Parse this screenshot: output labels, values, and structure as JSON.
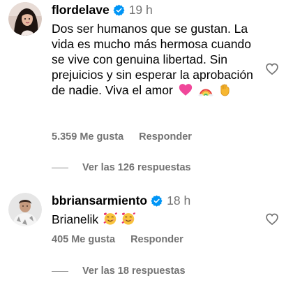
{
  "comments": [
    {
      "username": "flordelave",
      "verified": true,
      "time": "19 h",
      "text": "Dos ser humanos que se gustan. La vida es mucho más hermosa cuando se vive con genuina libertad. Sin prejuicios y sin esperar la aprobación de nadie. Viva el amor",
      "emojis": [
        "pink-heart-icon",
        "rainbow-icon",
        "raised-fist-icon"
      ],
      "likes_label": "5.359 Me gusta",
      "reply_label": "Responder",
      "view_replies_label": "Ver las 126 respuestas"
    },
    {
      "username": "bbriansarmiento",
      "verified": true,
      "time": "18 h",
      "text": "Brianelik",
      "emojis": [
        "smiling-face-with-hearts-icon",
        "smiling-face-with-hearts-icon"
      ],
      "likes_label": "405 Me gusta",
      "reply_label": "Responder",
      "view_replies_label": "Ver las 18 respuestas"
    }
  ],
  "colors": {
    "text_primary": "#000000",
    "text_secondary": "#737373",
    "verified_badge": "#0095F6",
    "divider": "#8e8e8e"
  }
}
